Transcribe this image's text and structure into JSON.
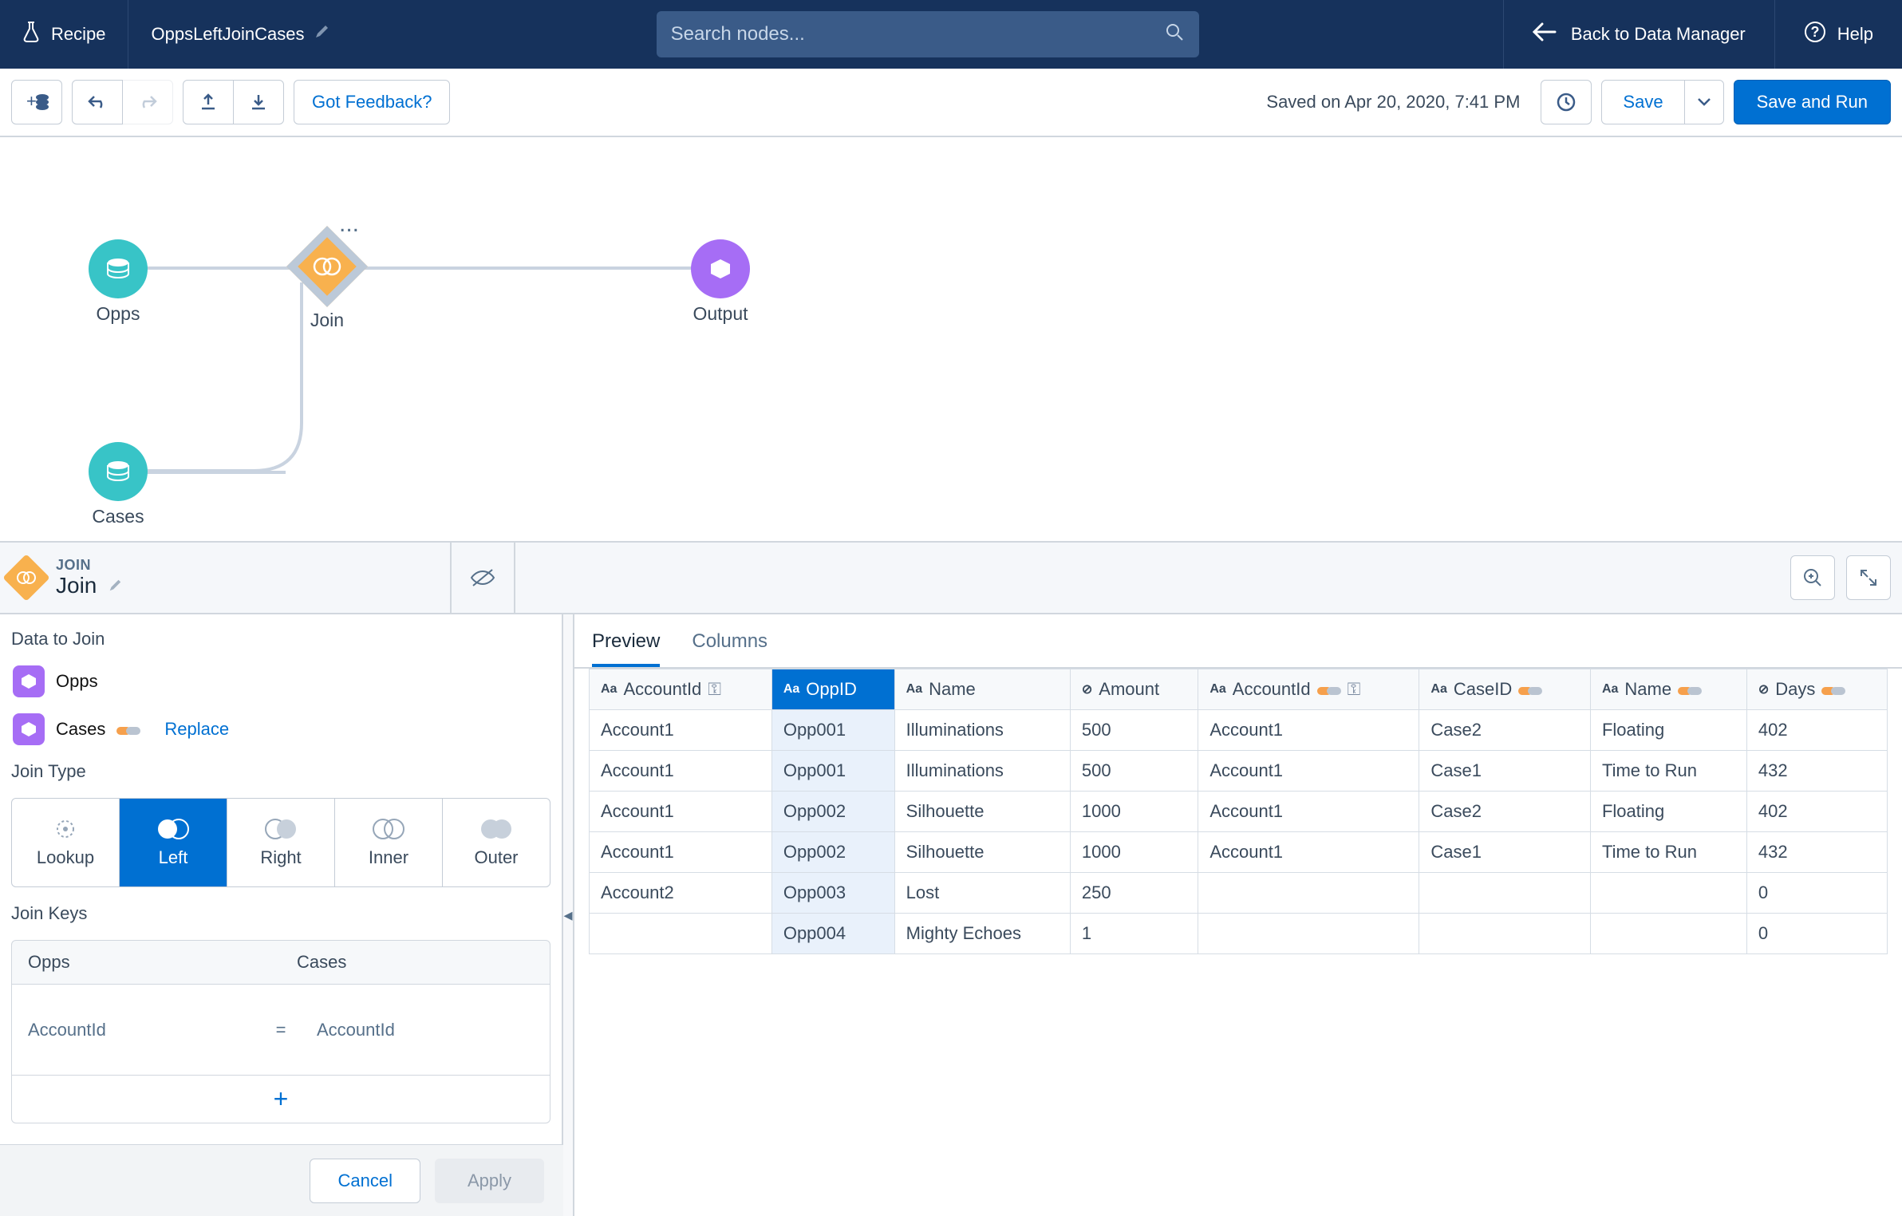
{
  "nav": {
    "recipe_label": "Recipe",
    "title": "OppsLeftJoinCases",
    "search_placeholder": "Search nodes...",
    "back_label": "Back to Data Manager",
    "help_label": "Help"
  },
  "toolbar": {
    "feedback": "Got Feedback?",
    "saved_status": "Saved on Apr 20, 2020, 7:41 PM",
    "save_label": "Save",
    "save_run_label": "Save and Run"
  },
  "canvas": {
    "nodes": {
      "opps": "Opps",
      "join": "Join",
      "output": "Output",
      "cases": "Cases"
    }
  },
  "join_panel": {
    "eyebrow": "JOIN",
    "title": "Join",
    "data_to_join_label": "Data to Join",
    "streams": [
      {
        "name": "Opps"
      },
      {
        "name": "Cases",
        "replace": "Replace"
      }
    ],
    "join_type_label": "Join Type",
    "join_types": [
      "Lookup",
      "Left",
      "Right",
      "Inner",
      "Outer"
    ],
    "join_type_selected": "Left",
    "join_keys_label": "Join Keys",
    "key_header_left": "Opps",
    "key_header_right": "Cases",
    "key_left": "AccountId",
    "key_right": "AccountId",
    "equals": "=",
    "cancel": "Cancel",
    "apply": "Apply"
  },
  "right_panel": {
    "tabs": [
      "Preview",
      "Columns"
    ],
    "active_tab": "Preview"
  },
  "table": {
    "columns": [
      {
        "name": "AccountId",
        "type": "text",
        "key": true
      },
      {
        "name": "OppID",
        "type": "text",
        "highlight": true
      },
      {
        "name": "Name",
        "type": "text"
      },
      {
        "name": "Amount",
        "type": "number"
      },
      {
        "name": "AccountId",
        "type": "text",
        "pills": true,
        "key": true
      },
      {
        "name": "CaseID",
        "type": "text",
        "pills": true
      },
      {
        "name": "Name",
        "type": "text",
        "pills": true
      },
      {
        "name": "Days",
        "type": "number",
        "pills": true
      }
    ],
    "rows": [
      [
        "Account1",
        "Opp001",
        "Illuminations",
        "500",
        "Account1",
        "Case2",
        "Floating",
        "402"
      ],
      [
        "Account1",
        "Opp001",
        "Illuminations",
        "500",
        "Account1",
        "Case1",
        "Time to Run",
        "432"
      ],
      [
        "Account1",
        "Opp002",
        "Silhouette",
        "1000",
        "Account1",
        "Case2",
        "Floating",
        "402"
      ],
      [
        "Account1",
        "Opp002",
        "Silhouette",
        "1000",
        "Account1",
        "Case1",
        "Time to Run",
        "432"
      ],
      [
        "Account2",
        "Opp003",
        "Lost",
        "250",
        "",
        "",
        "",
        "0"
      ],
      [
        "",
        "Opp004",
        "Mighty Echoes",
        "1",
        "",
        "",
        "",
        "0"
      ]
    ]
  }
}
